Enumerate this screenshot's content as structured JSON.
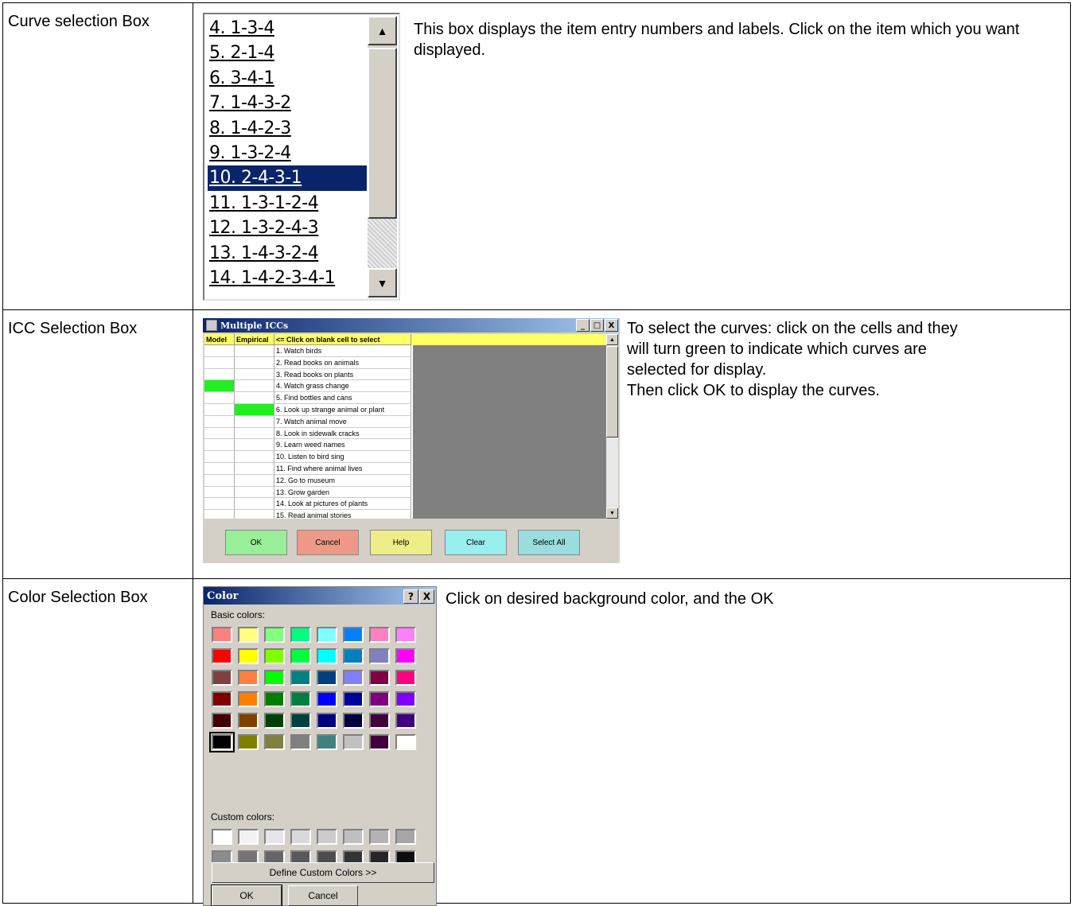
{
  "rows": [
    {
      "label": "Curve selection Box",
      "description": "This box displays the item entry numbers and labels. Click on the item which you want displayed."
    },
    {
      "label": "ICC Selection Box",
      "description_lines": [
        "To select the curves: click on the cells and they",
        "will turn green to indicate which curves are",
        "selected for display.",
        "Then click OK to display the curves."
      ]
    },
    {
      "label": "Color Selection Box",
      "description": "Click on desired background color, and the OK"
    }
  ],
  "curve_list": {
    "items": [
      "4. 1-3-4",
      "5. 2-1-4",
      "6. 3-4-1",
      "7. 1-4-3-2",
      "8. 1-4-2-3",
      "9. 1-3-2-4",
      "10. 2-4-3-1",
      "11. 1-3-1-2-4",
      "12. 1-3-2-4-3",
      "13. 1-4-3-2-4",
      "14. 1-4-2-3-4-1"
    ],
    "selected_index": 6,
    "scroll_up": "▲",
    "scroll_down": "▼"
  },
  "icc": {
    "title": "Multiple ICCs",
    "headers": [
      "Model",
      "Empirical",
      "<= Click on blank cell to select"
    ],
    "items": [
      {
        "label": "1. Watch birds",
        "model": false,
        "empirical": false
      },
      {
        "label": "2. Read books on animals",
        "model": false,
        "empirical": false
      },
      {
        "label": "3. Read books on plants",
        "model": false,
        "empirical": false
      },
      {
        "label": "4. Watch grass change",
        "model": true,
        "empirical": false
      },
      {
        "label": "5. Find bottles and cans",
        "model": false,
        "empirical": false
      },
      {
        "label": "6. Look up strange animal or plant",
        "model": false,
        "empirical": true
      },
      {
        "label": "7. Watch animal move",
        "model": false,
        "empirical": false
      },
      {
        "label": "8. Look in sidewalk cracks",
        "model": false,
        "empirical": false
      },
      {
        "label": "9. Learn weed names",
        "model": false,
        "empirical": false
      },
      {
        "label": "10. Listen to bird sing",
        "model": false,
        "empirical": false
      },
      {
        "label": "11. Find where animal lives",
        "model": false,
        "empirical": false
      },
      {
        "label": "12. Go to museum",
        "model": false,
        "empirical": false
      },
      {
        "label": "13. Grow garden",
        "model": false,
        "empirical": false
      },
      {
        "label": "14. Look at pictures of plants",
        "model": false,
        "empirical": false
      },
      {
        "label": "15. Read animal stories",
        "model": false,
        "empirical": false
      }
    ],
    "buttons": [
      {
        "label": "OK",
        "color": "#99ee99"
      },
      {
        "label": "Cancel",
        "color": "#ee9988"
      },
      {
        "label": "Help",
        "color": "#eeee88"
      },
      {
        "label": "Clear",
        "color": "#99eeee"
      },
      {
        "label": "Select All",
        "color": "#99dddd"
      }
    ],
    "minimize": "_",
    "maximize": "□",
    "close": "X"
  },
  "color_dialog": {
    "title": "Color",
    "help_btn": "?",
    "close_btn": "X",
    "basic_label": "Basic colors:",
    "custom_label": "Custom colors:",
    "basic_colors": [
      "#ff8080",
      "#ffff80",
      "#80ff80",
      "#00ff80",
      "#80ffff",
      "#0080ff",
      "#ff80c0",
      "#ff80ff",
      "#ff0000",
      "#ffff00",
      "#80ff00",
      "#00ff40",
      "#00ffff",
      "#0080c0",
      "#8080c0",
      "#ff00ff",
      "#804040",
      "#ff8040",
      "#00ff00",
      "#008080",
      "#004080",
      "#8080ff",
      "#800040",
      "#ff0080",
      "#800000",
      "#ff8000",
      "#008000",
      "#008040",
      "#0000ff",
      "#0000a0",
      "#800080",
      "#8000ff",
      "#400000",
      "#804000",
      "#004000",
      "#004040",
      "#000080",
      "#000040",
      "#400040",
      "#400080",
      "#000000",
      "#808000",
      "#808040",
      "#808080",
      "#408080",
      "#c0c0c0",
      "#400040",
      "#ffffff"
    ],
    "selected_color_index": 40,
    "custom_colors": [
      "#ffffff",
      "#f2f2f2",
      "#e6e6e6",
      "#d9d9d9",
      "#cccccc",
      "#bfbfbf",
      "#b3b3b3",
      "#a6a6a6",
      "#8c8c8c",
      "#737373",
      "#666666",
      "#595959",
      "#4d4d4d",
      "#333333",
      "#262626",
      "#0d0d0d"
    ],
    "define_button": "Define Custom Colors >>",
    "ok_button": "OK",
    "cancel_button": "Cancel"
  }
}
